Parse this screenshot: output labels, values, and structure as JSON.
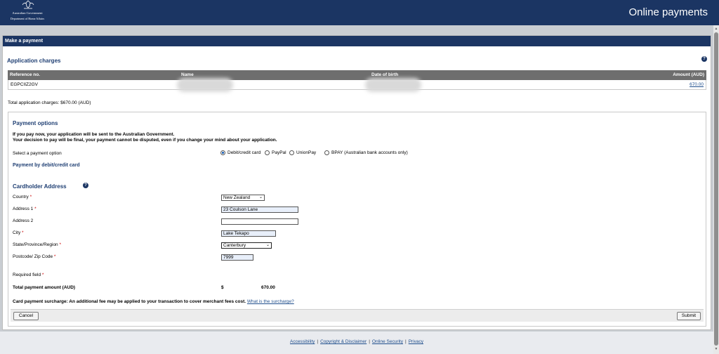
{
  "brand": {
    "gov_line1": "Australian Government",
    "gov_line2": "Department of Home Affairs",
    "title": "Online payments"
  },
  "card": {
    "header": "Make a payment"
  },
  "application_charges": {
    "heading": "Application charges",
    "help_icon": "?",
    "columns": {
      "reference": "Reference no.",
      "name": "Name",
      "dob": "Date of birth",
      "amount": "Amount (AUD)"
    },
    "rows": [
      {
        "reference": "EGPCIIZ2GV",
        "name": "",
        "dob": "",
        "amount": "670.00"
      }
    ],
    "total_line": "Total application charges: $670.00 (AUD)"
  },
  "payment_options": {
    "heading": "Payment options",
    "note_line1": "If you pay now, your application will be sent to the Australian Government.",
    "note_line2": "Your decision to pay will be final, your payment cannot be disputed, even if you change your mind about your application.",
    "select_label": "Select a payment option",
    "options": [
      {
        "label": "Debit/credit card",
        "selected": true
      },
      {
        "label": "PayPal",
        "selected": false
      },
      {
        "label": "UnionPay",
        "selected": false
      },
      {
        "label": "BPAY (Australian bank accounts only)",
        "selected": false
      }
    ],
    "method_heading": "Payment by debit/credit card"
  },
  "cardholder": {
    "heading": "Cardholder Address",
    "help_icon": "?",
    "required_marker": "*",
    "country": {
      "label": "Country",
      "value": "New Zealand"
    },
    "address1": {
      "label": "Address 1",
      "value": "23 Coulson Lane"
    },
    "address2": {
      "label": "Address 2",
      "value": ""
    },
    "city": {
      "label": "City",
      "value": "Lake Tekapo"
    },
    "state": {
      "label": "State/Province/Region",
      "value": "Canterbury"
    },
    "postcode": {
      "label": "Postcode/ Zip Code",
      "value": "7999"
    },
    "required_field": "Required field"
  },
  "summary": {
    "total_label": "Total payment amount (AUD)",
    "currency_symbol": "$",
    "total_value": "670.00",
    "surcharge_text": "Card payment surcharge: An additional fee may be applied to your transaction to cover merchant fees cost.",
    "surcharge_link": "What is the surcharge?"
  },
  "buttons": {
    "cancel": "Cancel",
    "submit": "Submit"
  },
  "footer": {
    "links": [
      "Accessibility",
      "Copyright & Disclaimer",
      "Online Security",
      "Privacy"
    ],
    "separator": "|"
  },
  "colors": {
    "header_navy": "#1b3563",
    "table_header_grey": "#6e6e6e",
    "link_blue": "#1f4e8c",
    "required_red": "#cc0000"
  },
  "icons": {
    "scroll_up": "▲",
    "scroll_down": "▼",
    "chevron": "⌄"
  }
}
